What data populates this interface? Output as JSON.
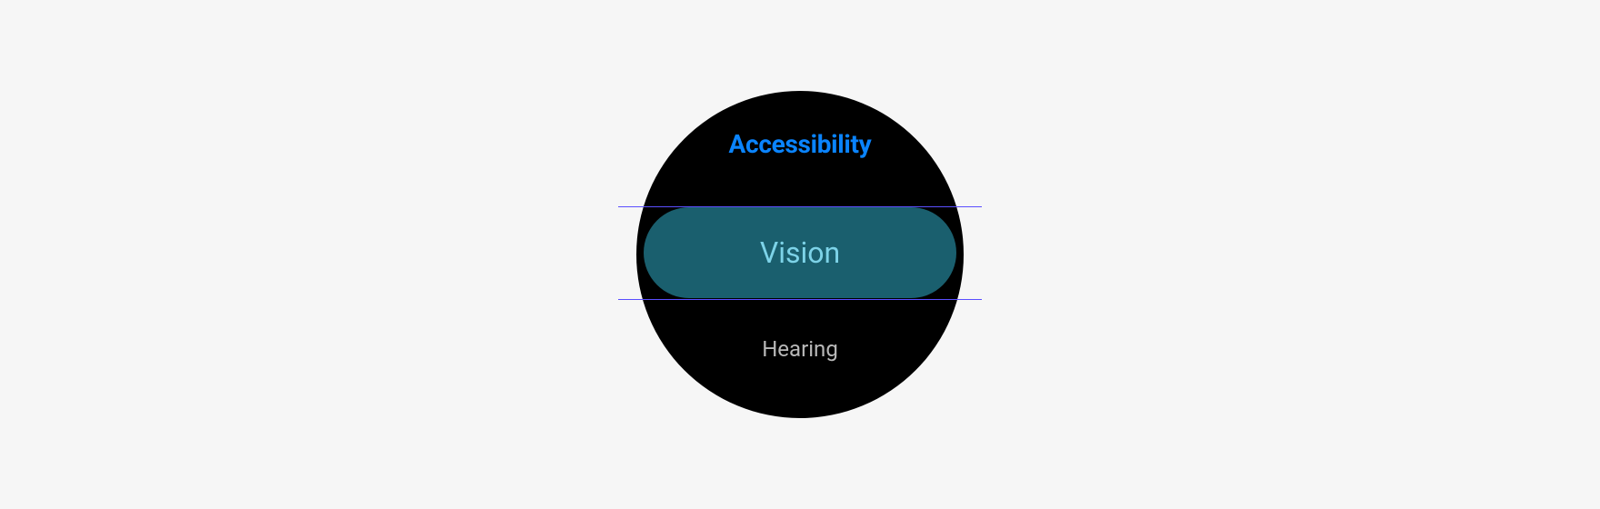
{
  "screen": {
    "title": "Accessibility",
    "items": [
      {
        "label": "Vision",
        "selected": true
      },
      {
        "label": "Hearing",
        "selected": false
      }
    ]
  }
}
